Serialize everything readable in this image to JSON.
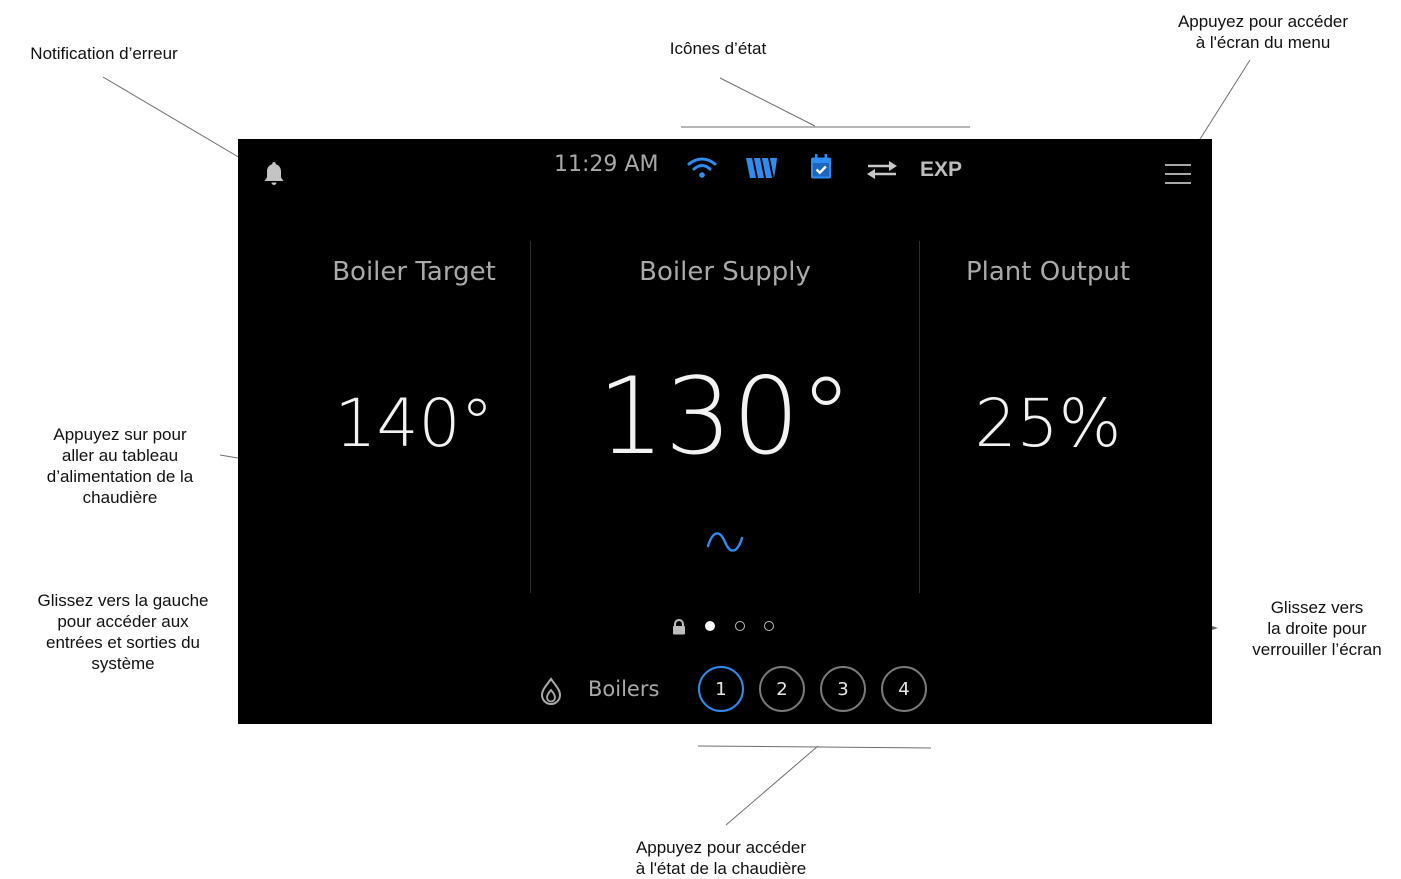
{
  "annotations": {
    "error_notification": "Notification d’erreur",
    "status_icons": "Icônes d’état",
    "menu_access": "Appuyez pour accéder\nà l'écran du menu",
    "power_chart": "Appuyez sur pour\naller au tableau\nd’alimentation de la\nchaudière",
    "swipe_left": "Glissez vers la gauche\npour accéder aux\nentrées et sorties du\nsystème",
    "swipe_right": "Glissez vers\nla droite pour\nverrouiller l’écran",
    "boiler_status": "Appuyez pour accéder\nà l'état de la chaudière"
  },
  "status_bar": {
    "time": "11:29 AM",
    "icons": [
      "wifi-icon",
      "brand-w-icon",
      "calendar-check-icon",
      "exchange-arrows-icon"
    ],
    "exp_label": "EXP"
  },
  "panels": [
    {
      "title": "Boiler Target",
      "value": "140°"
    },
    {
      "title": "Boiler Supply",
      "value": "130°"
    },
    {
      "title": "Plant Output",
      "value": "25%"
    }
  ],
  "pager": {
    "current_page": 1,
    "total_pages": 3,
    "locked_icon": "lock-icon"
  },
  "boilers": {
    "label": "Boilers",
    "items": [
      "1",
      "2",
      "3",
      "4"
    ],
    "selected": "1"
  },
  "colors": {
    "screen_bg": "#000000",
    "accent_blue": "#2f8cf0",
    "text_gray": "#a9a9a9",
    "value_white": "#f2f2f2"
  }
}
